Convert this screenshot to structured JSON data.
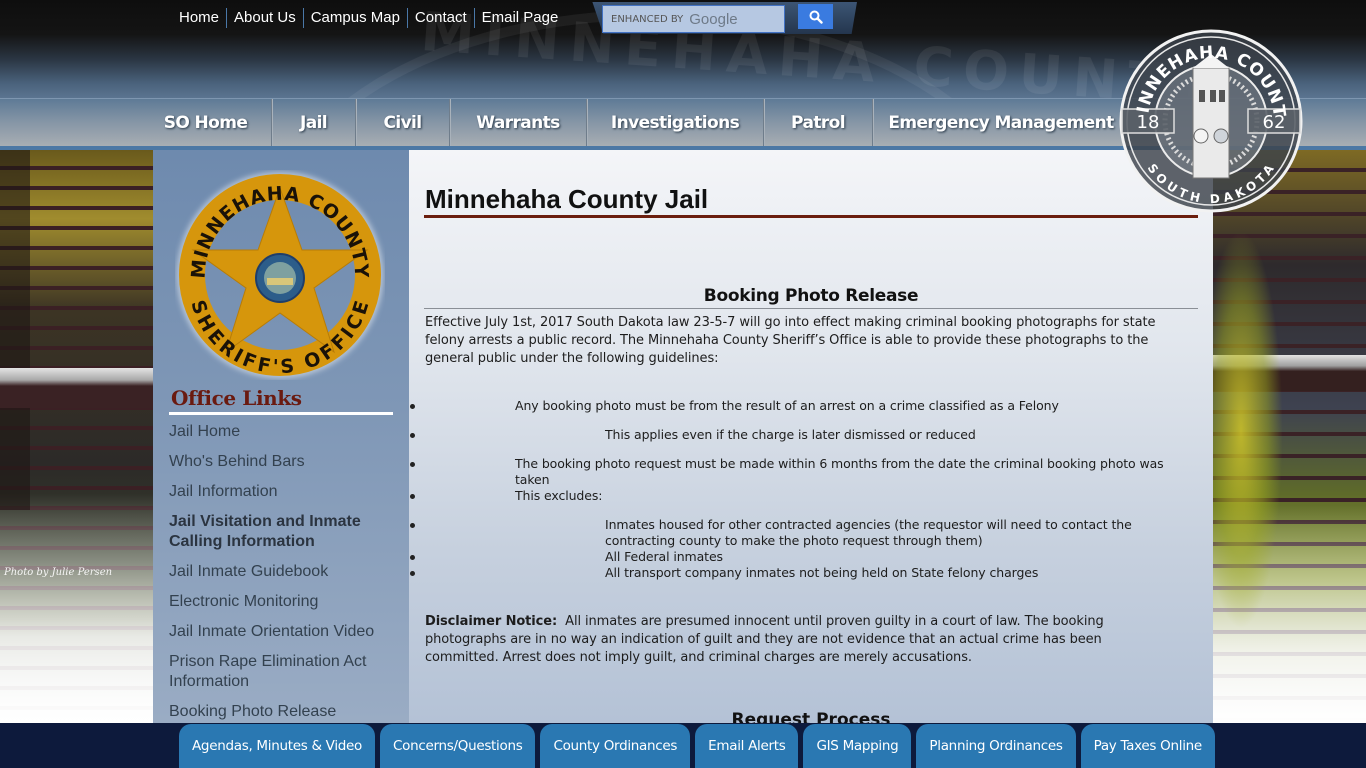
{
  "header": {
    "top_links": [
      "Home",
      "About Us",
      "Campus Map",
      "Contact",
      "Email Page"
    ],
    "search": {
      "placeholder_prefix": "ENHANCED BY",
      "placeholder_brand": "Google",
      "button_icon": "search-icon"
    },
    "watermark_text": "MINNEHAHA COUNTY"
  },
  "main_nav": {
    "items": [
      "SO Home",
      "Jail",
      "Civil",
      "Warrants",
      "Investigations",
      "Patrol",
      "Emergency Management"
    ]
  },
  "county_seal": {
    "top_text": "MINNEHAHA COUNTY",
    "year_left": "18",
    "year_right": "62",
    "bottom_text": "SOUTH DAKOTA"
  },
  "sidebar": {
    "badge": {
      "top_text": "MINNEHAHA COUNTY",
      "bottom_text": "SHERIFF'S OFFICE"
    },
    "office_links_title": "Office Links",
    "links": [
      {
        "label": "Jail Home",
        "bold": false
      },
      {
        "label": "Who's Behind Bars",
        "bold": false
      },
      {
        "label": "Jail Information",
        "bold": false
      },
      {
        "label": "Jail Visitation and Inmate Calling Information",
        "bold": true
      },
      {
        "label": "Jail Inmate Guidebook",
        "bold": false
      },
      {
        "label": "Electronic Monitoring",
        "bold": false
      },
      {
        "label": "Jail Inmate Orientation Video",
        "bold": false
      },
      {
        "label": "Prison Rape Elimination Act Information",
        "bold": false
      },
      {
        "label": "Booking Photo Release",
        "bold": false
      }
    ],
    "photo_credit": "Photo by Julie Persen"
  },
  "content": {
    "page_title": "Minnehaha County Jail",
    "section_heading": "Booking Photo Release",
    "intro": "Effective July 1st, 2017 South Dakota law 23-5-7 will go into effect making criminal booking photographs for state felony arrests a public record. The Minnehaha County Sheriff’s Office is able to provide these photographs to the general public under the following guidelines:",
    "bullets": {
      "b1": "Any booking photo must be from the result of an arrest on a crime classified as a Felony",
      "b1_sub": "This applies even if the charge is later dismissed or reduced",
      "b2": "The booking photo request must be made within 6 months from the date the criminal booking photo was taken",
      "b3": "This excludes:",
      "b3_sub": [
        "Inmates housed for other contracted agencies (the requestor will need to contact the contracting county to make the photo request through them)",
        "All Federal inmates",
        "All transport company inmates not being held on State felony charges"
      ]
    },
    "disclaimer_label": "Disclaimer Notice:",
    "disclaimer_text": "All inmates are presumed innocent until proven guilty in a court of law.  The booking photographs are in no way an indication of guilt and they are not evidence that an actual crime has been committed.  Arrest does not imply guilt, and criminal charges are merely accusations.",
    "request_heading": "Request Process"
  },
  "footer": {
    "buttons": [
      "Agendas, Minutes & Video",
      "Concerns/Questions",
      "County Ordinances",
      "Email Alerts",
      "GIS Mapping",
      "Planning Ordinances",
      "Pay Taxes Online"
    ]
  },
  "colors": {
    "title_rule": "#6b1e0e",
    "office_links_title": "#6a1a10",
    "badge_gold": "#d6960c",
    "footer_button": "#2a78b2",
    "footer_bg": "#0d1a3c",
    "search_button": "#3a7be0"
  }
}
